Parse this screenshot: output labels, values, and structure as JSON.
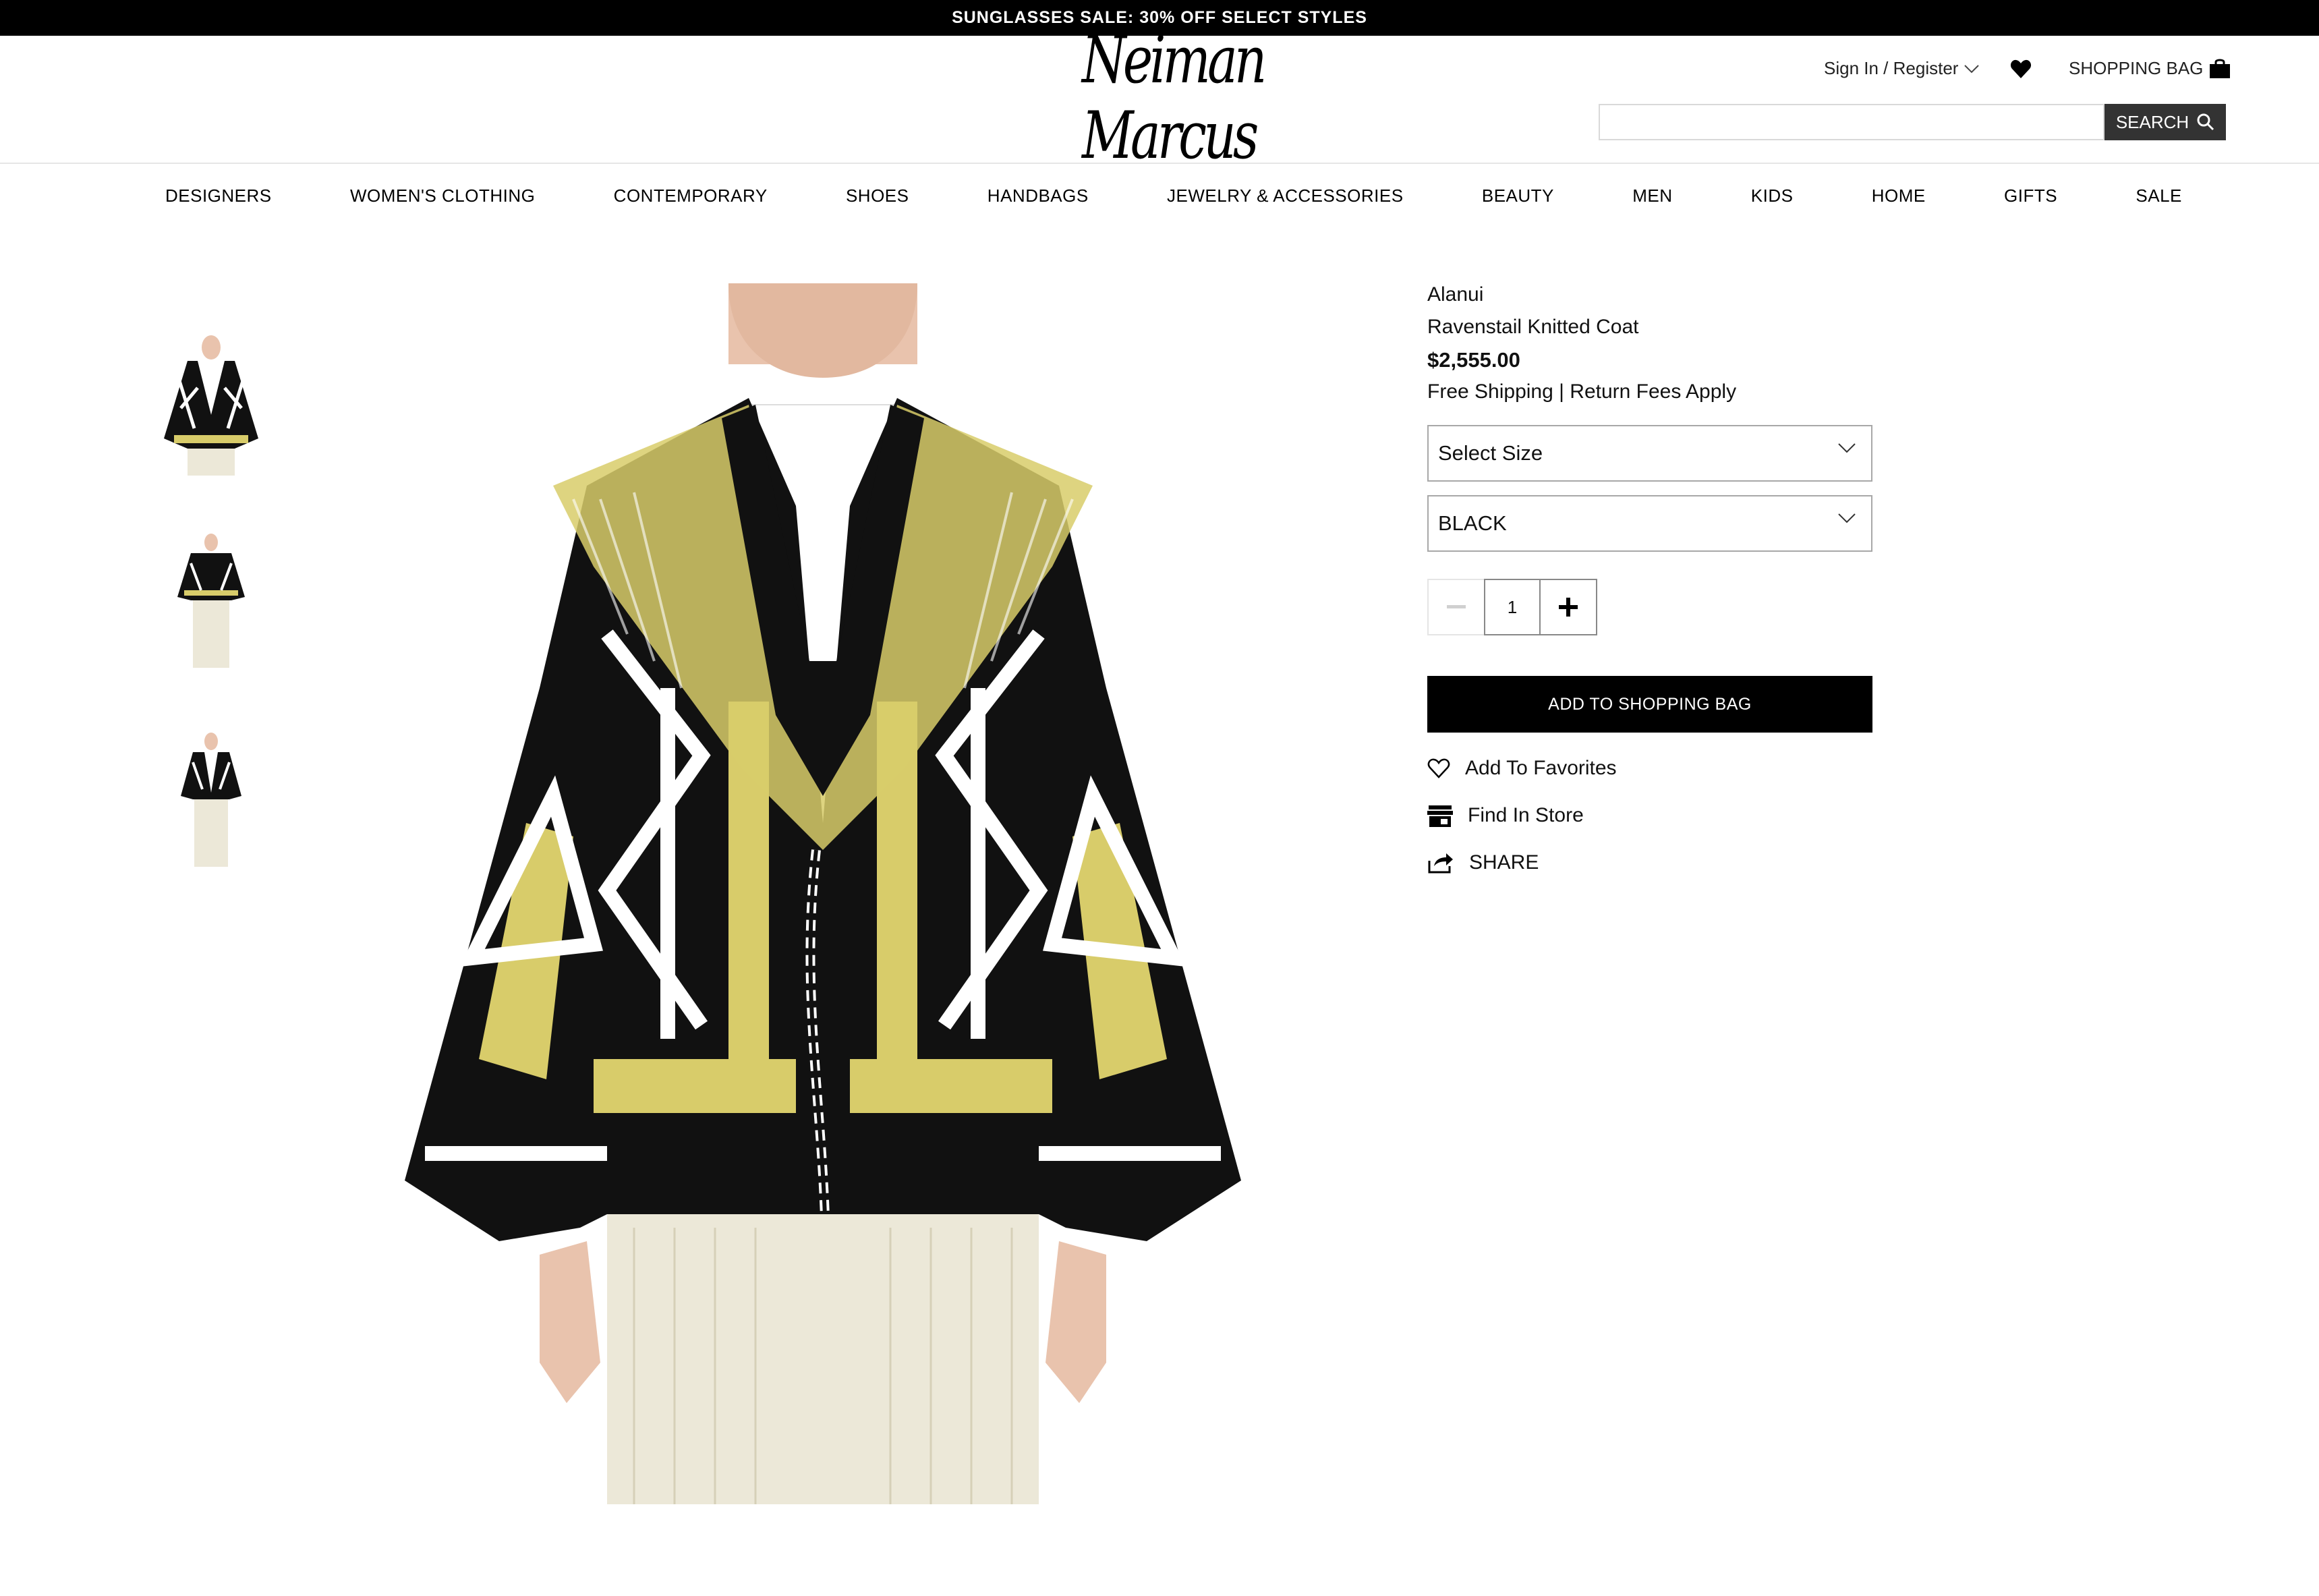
{
  "promo": {
    "text": "SUNGLASSES SALE: 30% OFF SELECT STYLES"
  },
  "header": {
    "logo_text": "Neiman Marcus",
    "sign_in": "Sign In / Register",
    "bag_label": "SHOPPING BAG",
    "search_placeholder": "",
    "search_button": "SEARCH"
  },
  "nav": {
    "items": [
      "DESIGNERS",
      "WOMEN'S CLOTHING",
      "CONTEMPORARY",
      "SHOES",
      "HANDBAGS",
      "JEWELRY & ACCESSORIES",
      "BEAUTY",
      "MEN",
      "KIDS",
      "HOME",
      "GIFTS",
      "SALE"
    ]
  },
  "product": {
    "brand": "Alanui",
    "name": "Ravenstail Knitted Coat",
    "price": "$2,555.00",
    "shipping": "Free Shipping",
    "returns": "Return Fees Apply",
    "size_select": "Select Size",
    "color_select": "BLACK",
    "quantity": "1",
    "add_to_bag": "ADD TO SHOPPING BAG",
    "add_favorites": "Add To Favorites",
    "find_in_store": "Find In Store",
    "share": "SHARE"
  },
  "colors": {
    "black": "#000000",
    "knit_yellow": "#d8cc6a",
    "lace_cream": "#ece8d8",
    "skin": "#e9c3ad",
    "tee_white": "#ffffff"
  }
}
